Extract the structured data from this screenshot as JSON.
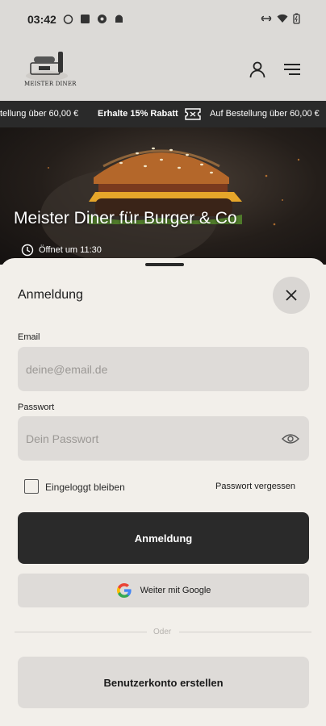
{
  "status_bar": {
    "time": "03:42"
  },
  "header": {
    "logo_text": "MEISTER DINER"
  },
  "ticker": {
    "items": [
      "tellung über 60,00 €",
      "Erhalte 15% Rabatt",
      "Auf Bestellung über 60,00 €"
    ]
  },
  "hero": {
    "title": "Meister Diner für Burger & Co",
    "hours": "Öffnet um 11:30"
  },
  "login": {
    "title": "Anmeldung",
    "email_label": "Email",
    "email_placeholder": "deine@email.de",
    "password_label": "Passwort",
    "password_placeholder": "Dein Passwort",
    "remember_label": "Eingeloggt bleiben",
    "forgot_label": "Passwort vergessen",
    "submit_label": "Anmeldung",
    "google_label": "Weiter mit Google",
    "or_label": "Oder",
    "create_account_label": "Benutzerkonto erstellen"
  },
  "colors": {
    "dark": "#2a2a2a",
    "sheet": "#f2efea",
    "field": "#dedbd8",
    "header": "#dcdad7"
  }
}
